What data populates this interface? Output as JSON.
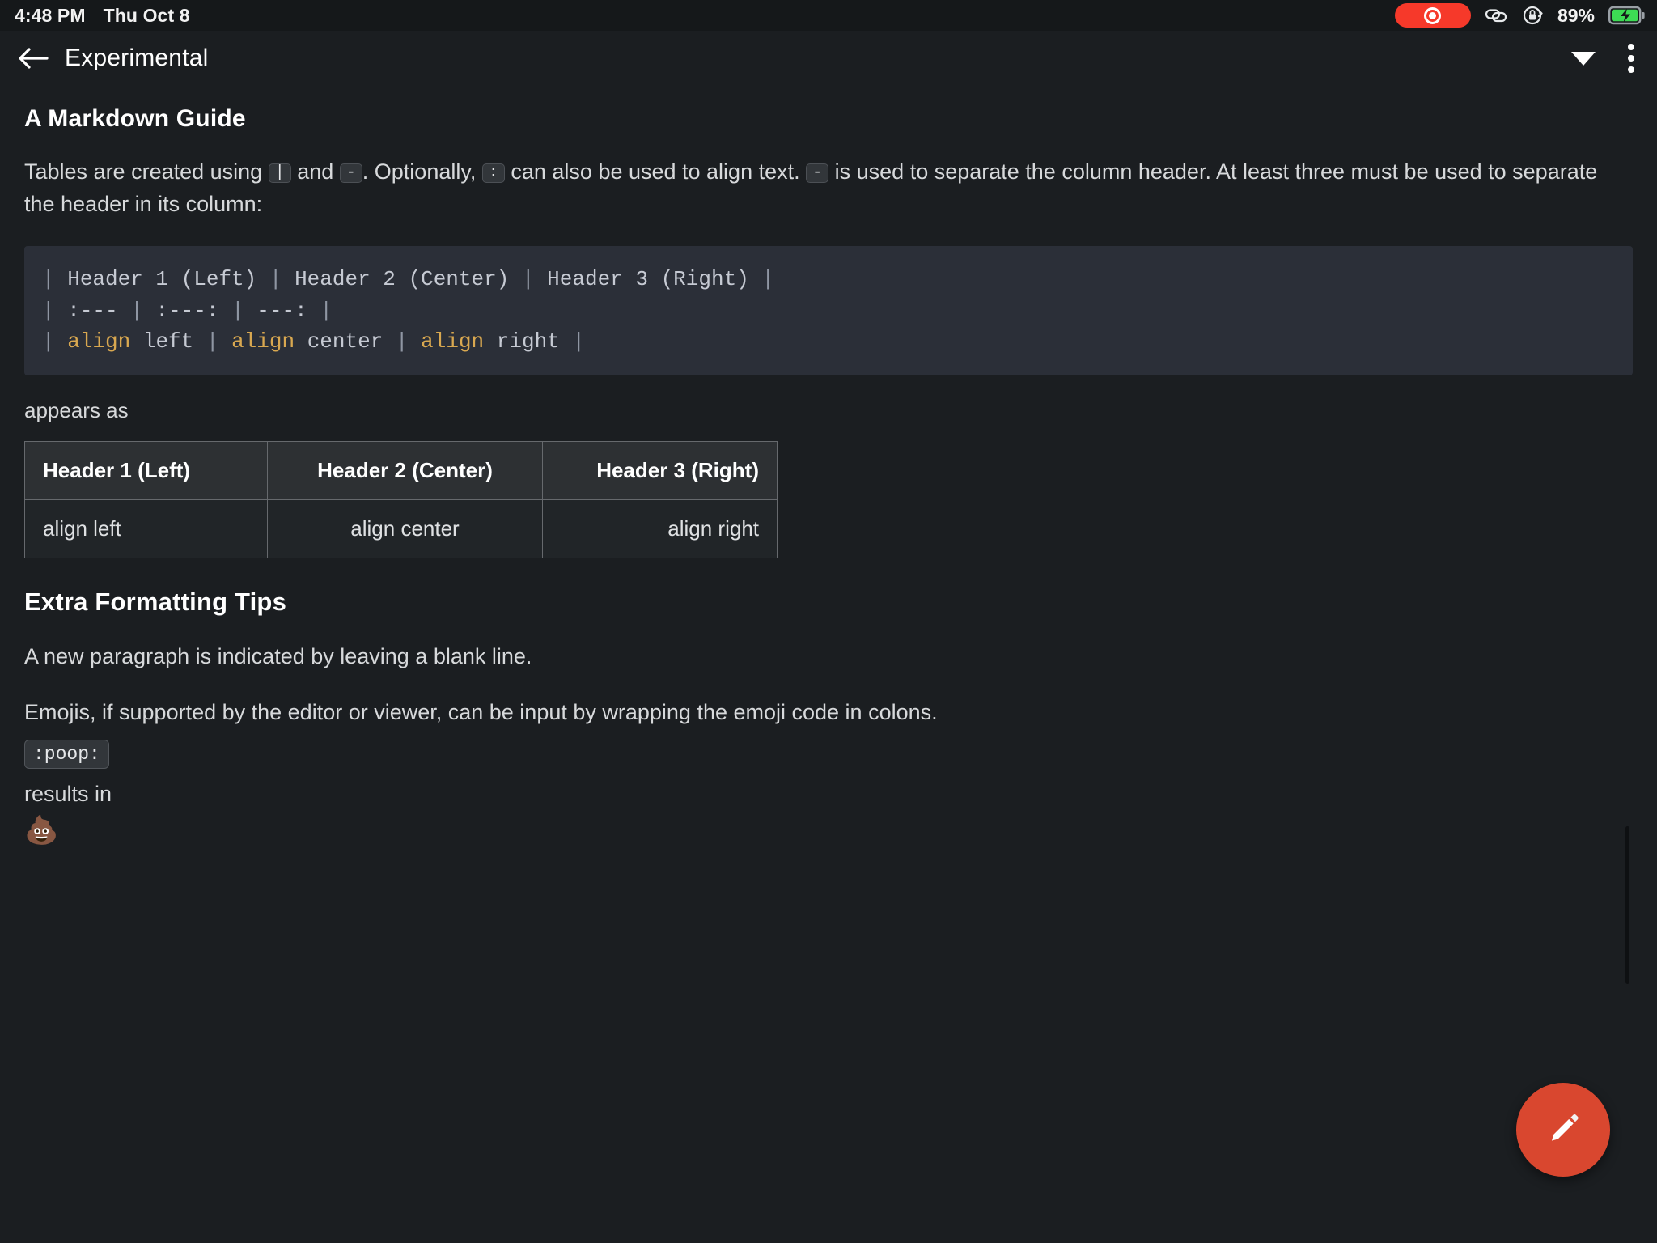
{
  "statusbar": {
    "time": "4:48 PM",
    "date": "Thu Oct 8",
    "battery_percent": "89%",
    "icons": [
      "recording-pill-icon",
      "link-icon",
      "rotation-lock-icon",
      "battery-charging-icon"
    ],
    "recording_color": "#f6392a",
    "battery_color": "#3ddc54"
  },
  "appbar": {
    "back_label": "back-arrow",
    "title": "Experimental",
    "dropdown_label": "chevron-down",
    "overflow_label": "more-options"
  },
  "document": {
    "title": "A Markdown Guide",
    "intro": {
      "seg1": "Tables are created using ",
      "code1": "|",
      "seg2": " and ",
      "code2": "-",
      "seg3": ". Optionally, ",
      "code3": ":",
      "seg4": " can also be used to align text. ",
      "code4": "-",
      "seg5": " is used to separate the column header. At least three must be used to separate the header in its column:"
    },
    "codeblock": {
      "line1": {
        "p0": "| ",
        "t0": "Header 1 (Left) ",
        "p1": "| ",
        "t1": "Header 2 (Center) ",
        "p2": "| ",
        "t2": "Header 3 (Right) ",
        "p3": "|"
      },
      "line2": {
        "p0": "| ",
        "t0": ":--- ",
        "p1": "| ",
        "t1": ":---: ",
        "p2": "| ",
        "t2": "---: ",
        "p3": "|"
      },
      "line3": {
        "p0": "| ",
        "kw0": "align",
        "t0": " left ",
        "p1": "| ",
        "kw1": "align",
        "t1": " center ",
        "p2": "| ",
        "kw2": "align",
        "t2": " right ",
        "p3": "|"
      }
    },
    "appears_as": "appears as",
    "table": {
      "headers": [
        "Header 1 (Left)",
        "Header 2 (Center)",
        "Header 3 (Right)"
      ],
      "rows": [
        [
          "align left",
          "align center",
          "align right"
        ]
      ],
      "alignments": [
        "left",
        "center",
        "right"
      ]
    },
    "section2": {
      "heading": "Extra Formatting Tips",
      "para1": "A new paragraph is indicated by leaving a blank line.",
      "para2": "Emojis, if supported by the editor or viewer, can be input by wrapping the emoji code in colons.",
      "emoji_code": ":poop:",
      "results_in": "results in",
      "emoji_glyph": "💩"
    }
  },
  "fab": {
    "label": "compose-note",
    "color": "#d9472f"
  }
}
